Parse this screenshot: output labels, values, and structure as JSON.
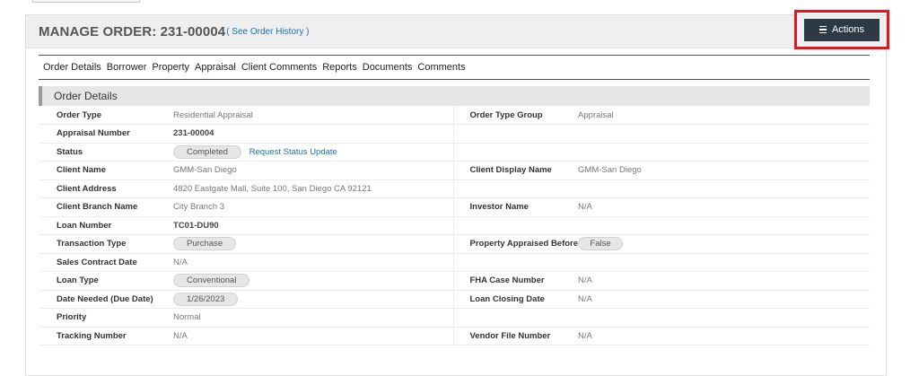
{
  "header": {
    "title": "MANAGE ORDER: 231-00004",
    "history_link": "( See Order History )",
    "actions_label": "Actions"
  },
  "tabs": [
    "Order Details",
    "Borrower",
    "Property",
    "Appraisal",
    "Client Comments",
    "Reports",
    "Documents",
    "Comments"
  ],
  "section": {
    "title": "Order Details"
  },
  "details": {
    "order_type": {
      "label": "Order Type",
      "value": "Residential Appraisal"
    },
    "order_type_group": {
      "label": "Order Type Group",
      "value": "Appraisal"
    },
    "appraisal_number": {
      "label": "Appraisal Number",
      "value": "231-00004"
    },
    "status": {
      "label": "Status",
      "value": "Completed",
      "link": "Request Status Update"
    },
    "client_name": {
      "label": "Client Name",
      "value": "GMM-San Diego"
    },
    "client_display_name": {
      "label": "Client Display Name",
      "value": "GMM-San Diego"
    },
    "client_address": {
      "label": "Client Address",
      "value": "4820 Eastgate Mall, Suite 100, San Diego CA 92121"
    },
    "client_branch_name": {
      "label": "Client Branch Name",
      "value": "City Branch 3"
    },
    "investor_name": {
      "label": "Investor Name",
      "value": "N/A"
    },
    "loan_number": {
      "label": "Loan Number",
      "value": "TC01-DU90"
    },
    "transaction_type": {
      "label": "Transaction Type",
      "value": "Purchase"
    },
    "property_appraised_before": {
      "label": "Property Appraised Before",
      "value": "False"
    },
    "sales_contract_date": {
      "label": "Sales Contract Date",
      "value": "N/A"
    },
    "loan_type": {
      "label": "Loan Type",
      "value": "Conventional"
    },
    "fha_case_number": {
      "label": "FHA Case Number",
      "value": "N/A"
    },
    "date_needed": {
      "label": "Date Needed (Due Date)",
      "value": "1/26/2023"
    },
    "loan_closing_date": {
      "label": "Loan Closing Date",
      "value": "N/A"
    },
    "priority": {
      "label": "Priority",
      "value": "Normal"
    },
    "tracking_number": {
      "label": "Tracking Number",
      "value": "N/A"
    },
    "vendor_file_number": {
      "label": "Vendor File Number",
      "value": "N/A"
    }
  },
  "colors": {
    "actions_button": "#2d3a45",
    "highlight_border": "#e8141a",
    "link": "#1a6fb5"
  }
}
